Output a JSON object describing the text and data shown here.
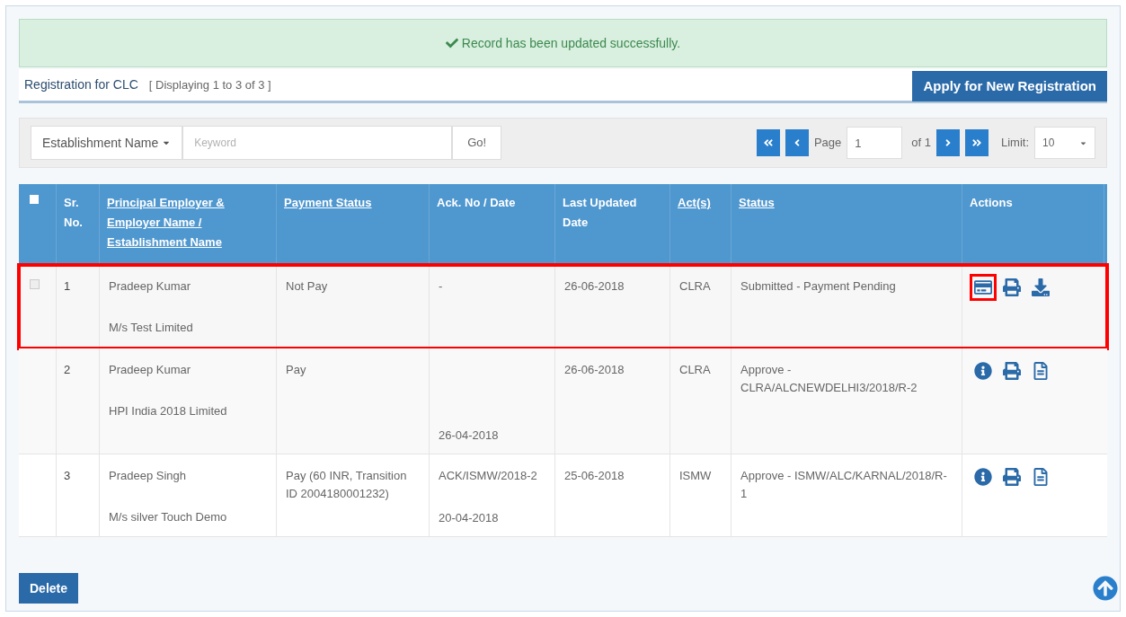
{
  "alert": {
    "message": "Record has been updated successfully."
  },
  "header": {
    "title": "Registration for CLC",
    "count": "[ Displaying 1 to 3 of 3 ]",
    "apply_button": "Apply for New Registration"
  },
  "search": {
    "filter": "Establishment Name",
    "placeholder": "Keyword",
    "go_button": "Go!"
  },
  "pager": {
    "page_label": "Page",
    "page": "1",
    "of": "of 1",
    "limit_label": "Limit:",
    "limit": "10"
  },
  "table": {
    "select_all_checked": false,
    "columns": [
      {
        "label": "Sr. No.",
        "sortable": false
      },
      {
        "label": "Principal Employer & Employer Name / Establishment Name",
        "sortable": true
      },
      {
        "label": "Payment Status",
        "sortable": true
      },
      {
        "label": "Ack. No / Date",
        "sortable": false
      },
      {
        "label": "Last Updated Date",
        "sortable": false
      },
      {
        "label": "Act(s)",
        "sortable": true
      },
      {
        "label": "Status",
        "sortable": true
      },
      {
        "label": "Actions",
        "sortable": false
      }
    ],
    "rows": [
      {
        "highlighted": true,
        "checked": false,
        "sr": "1",
        "employer": "Pradeep Kumar",
        "establishment": "M/s Test Limited",
        "payment": "Not Pay",
        "ack_no": "-",
        "ack_date": "",
        "updated": "26-06-2018",
        "act": "CLRA",
        "status": "Submitted - Payment Pending",
        "actions": [
          {
            "kind": "payment",
            "highlighted": true
          },
          {
            "kind": "print",
            "highlighted": false
          },
          {
            "kind": "download",
            "highlighted": false
          }
        ]
      },
      {
        "highlighted": false,
        "sr": "2",
        "employer": "Pradeep Kumar",
        "establishment": "HPI India 2018 Limited",
        "payment": "Pay",
        "ack_no": "",
        "ack_date": "26-04-2018",
        "updated": "26-06-2018",
        "act": "CLRA",
        "status": "Approve - CLRA/ALCNEWDELHI3/2018/R-2",
        "actions": [
          {
            "kind": "info",
            "highlighted": false
          },
          {
            "kind": "print",
            "highlighted": false
          },
          {
            "kind": "document",
            "highlighted": false
          }
        ]
      },
      {
        "highlighted": false,
        "sr": "3",
        "employer": "Pradeep Singh",
        "establishment": "M/s silver Touch Demo",
        "payment": "Pay (60 INR, Transition ID 2004180001232)",
        "ack_no": "ACK/ISMW/2018-2",
        "ack_date": "20-04-2018",
        "updated": "25-06-2018",
        "act": "ISMW",
        "status": "Approve - ISMW/ALC/KARNAL/2018/R-1",
        "actions": [
          {
            "kind": "info",
            "highlighted": false
          },
          {
            "kind": "print",
            "highlighted": false
          },
          {
            "kind": "document",
            "highlighted": false
          }
        ]
      }
    ]
  },
  "delete_button": "Delete"
}
